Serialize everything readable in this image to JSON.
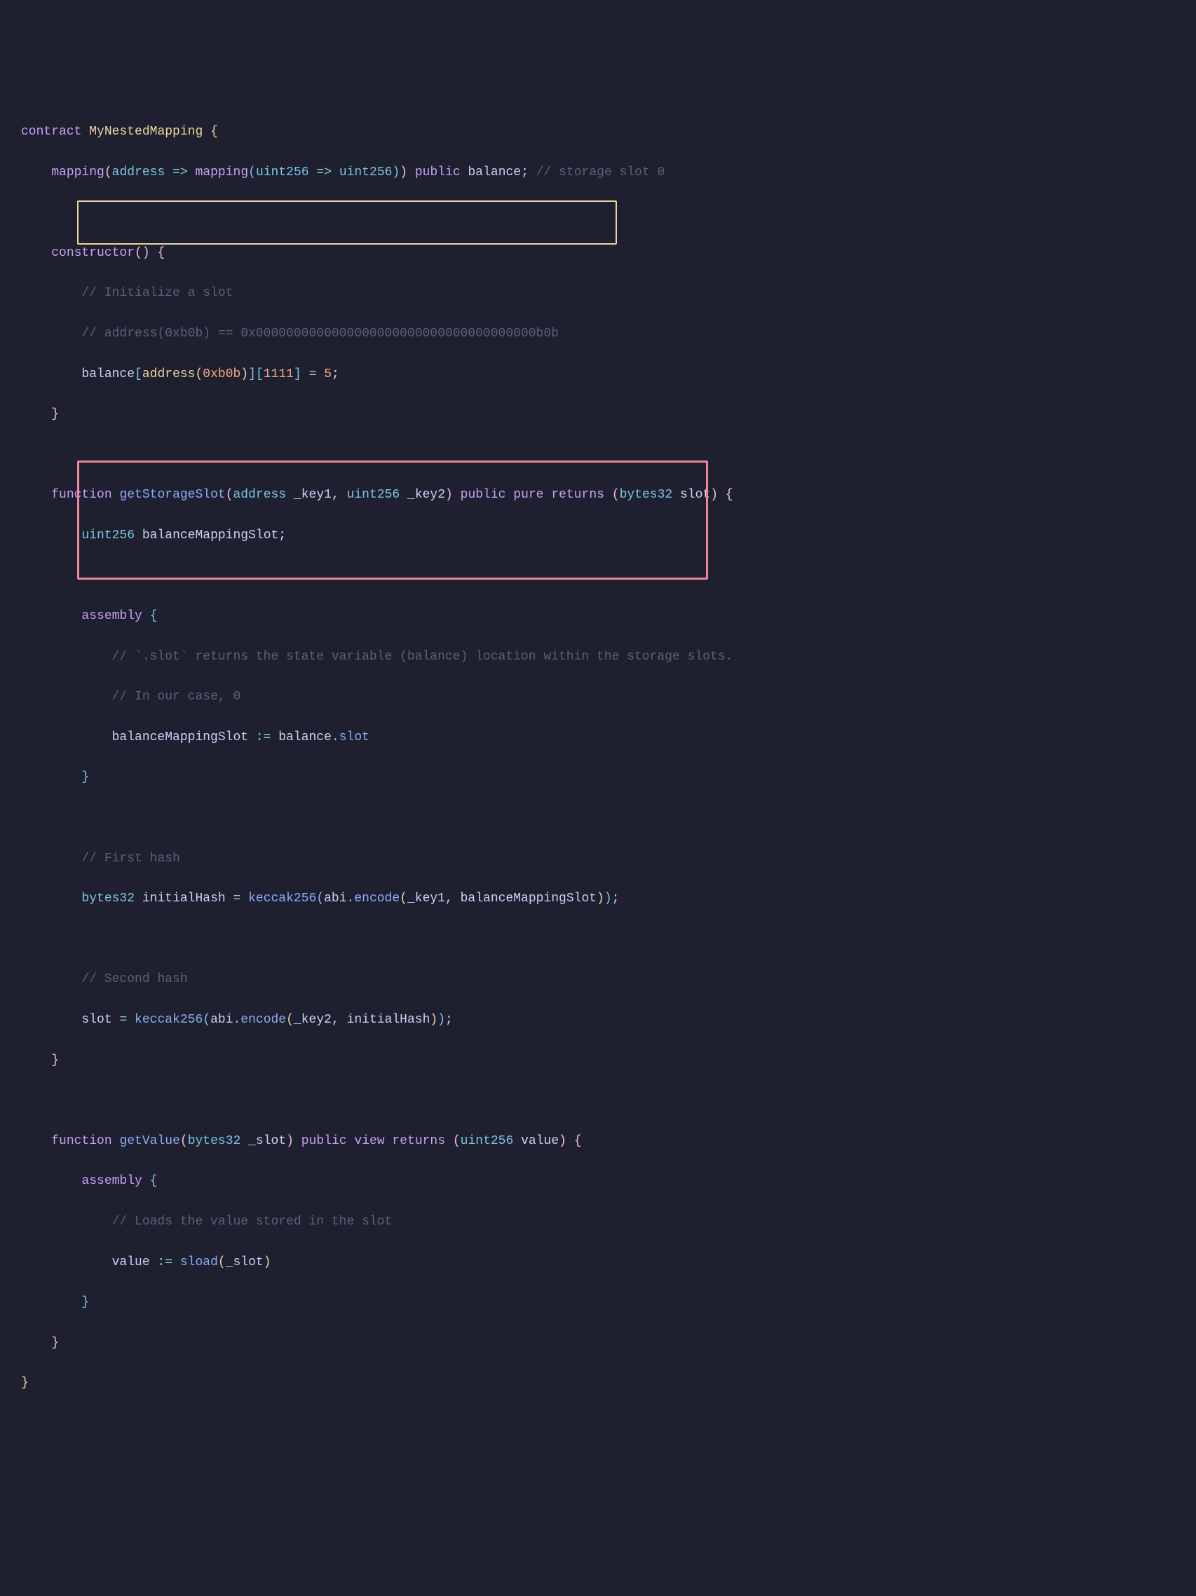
{
  "code": {
    "l1": {
      "kw_contract": "contract",
      "name": "MyNestedMapping",
      "brace": "{"
    },
    "l2": {
      "kw_mapping1": "mapping",
      "p1": "(",
      "type_addr": "address",
      "arrow1": "=>",
      "kw_mapping2": "mapping",
      "p2": "(",
      "type_uint1": "uint256",
      "arrow2": "=>",
      "type_uint2": "uint256",
      "p3": ")",
      "p4": ")",
      "kw_public": "public",
      "var": "balance",
      "semi": ";",
      "comment": "// storage slot 0"
    },
    "l4": {
      "kw": "constructor",
      "parens": "()",
      "brace": "{"
    },
    "l5": {
      "comment": "// Initialize a slot"
    },
    "l6": {
      "comment": "// address(0xb0b) == 0x0000000000000000000000000000000000000b0b"
    },
    "l7": {
      "var": "balance",
      "b1": "[",
      "func": "address",
      "p1": "(",
      "hex": "0xb0b",
      "p2": ")",
      "b2": "]",
      "b3": "[",
      "num": "1111",
      "b4": "]",
      "eq": " = ",
      "val": "5",
      "semi": ";"
    },
    "l8": {
      "brace": "}"
    },
    "l10": {
      "kw_function": "function",
      "name": "getStorageSlot",
      "p1": "(",
      "type1": "address",
      "param1": "_key1",
      "comma": ",",
      "type2": "uint256",
      "param2": "_key2",
      "p2": ")",
      "kw_public": "public",
      "kw_pure": "pure",
      "kw_returns": "returns",
      "p3": "(",
      "type3": "bytes32",
      "param3": "slot",
      "p4": ")",
      "brace": "{"
    },
    "l11": {
      "type": "uint256",
      "var": "balanceMappingSlot",
      "semi": ";"
    },
    "l13": {
      "kw": "assembly",
      "brace": "{"
    },
    "l14": {
      "comment": "// `.slot` returns the state variable (balance) location within the storage slots."
    },
    "l15": {
      "comment": "// In our case, 0"
    },
    "l16": {
      "var1": "balanceMappingSlot",
      "op": ":=",
      "var2": "balance",
      "dot": ".",
      "prop": "slot"
    },
    "l17": {
      "brace": "}"
    },
    "l19": {
      "comment": "// First hash"
    },
    "l20": {
      "type": "bytes32",
      "var": "initialHash",
      "eq": " = ",
      "func1": "keccak256",
      "p1": "(",
      "obj": "abi",
      "dot": ".",
      "func2": "encode",
      "p2": "(",
      "arg1": "_key1",
      "comma": ",",
      "arg2": "balanceMappingSlot",
      "p3": ")",
      "p4": ")",
      "semi": ";"
    },
    "l22": {
      "comment": "// Second hash"
    },
    "l23": {
      "var": "slot",
      "eq": " = ",
      "func1": "keccak256",
      "p1": "(",
      "obj": "abi",
      "dot": ".",
      "func2": "encode",
      "p2": "(",
      "arg1": "_key2",
      "comma": ",",
      "arg2": "initialHash",
      "p3": ")",
      "p4": ")",
      "semi": ";"
    },
    "l24": {
      "brace": "}"
    },
    "l26": {
      "kw_function": "function",
      "name": "getValue",
      "p1": "(",
      "type1": "bytes32",
      "param1": "_slot",
      "p2": ")",
      "kw_public": "public",
      "kw_view": "view",
      "kw_returns": "returns",
      "p3": "(",
      "type2": "uint256",
      "param2": "value",
      "p4": ")",
      "brace": "{"
    },
    "l27": {
      "kw": "assembly",
      "brace": "{"
    },
    "l28": {
      "comment": "// Loads the value stored in the slot"
    },
    "l29": {
      "var": "value",
      "op": ":=",
      "func": "sload",
      "p1": "(",
      "arg": "_slot",
      "p2": ")"
    },
    "l30": {
      "brace": "}"
    },
    "l31": {
      "brace": "}"
    },
    "l32": {
      "brace": "}"
    }
  }
}
